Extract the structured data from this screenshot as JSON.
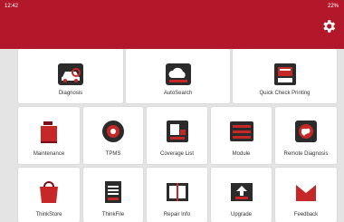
{
  "status": {
    "time": "12:42",
    "battery": "22%"
  },
  "header": {
    "color": "#b3182a"
  },
  "tiles": {
    "diagnosis": "Diagnosis",
    "autosearch": "AutoSearch",
    "quick_check": "Quick Check Printing",
    "maintenance": "Maintenance",
    "tpms": "TPMS",
    "coverage": "Coverage List",
    "module": "Module",
    "remote": "Remote Diagnosis",
    "thinkstore": "ThinkStore",
    "thinkfile": "ThinkFile",
    "repair_info": "Repair Info",
    "upgrade": "Upgrade",
    "feedback": "Feedback"
  }
}
